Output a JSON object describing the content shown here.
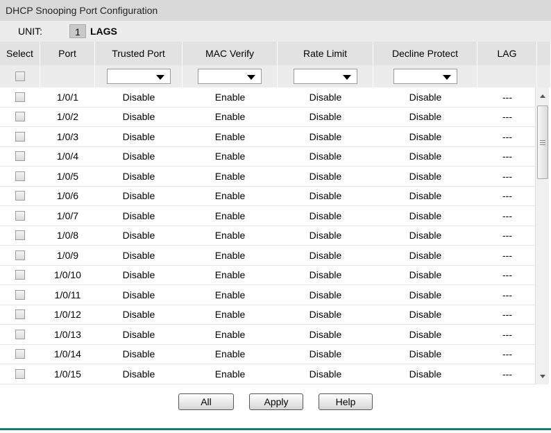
{
  "panel": {
    "title": "DHCP Snooping Port Configuration"
  },
  "unit": {
    "label": "UNIT:",
    "number": "1",
    "lags": "LAGS"
  },
  "columns": [
    "Select",
    "Port",
    "Trusted Port",
    "MAC Verify",
    "Rate Limit",
    "Decline Protect",
    "LAG"
  ],
  "rows": [
    {
      "port": "1/0/1",
      "trusted": "Disable",
      "mac": "Enable",
      "rate": "Disable",
      "decline": "Disable",
      "lag": "---"
    },
    {
      "port": "1/0/2",
      "trusted": "Disable",
      "mac": "Enable",
      "rate": "Disable",
      "decline": "Disable",
      "lag": "---"
    },
    {
      "port": "1/0/3",
      "trusted": "Disable",
      "mac": "Enable",
      "rate": "Disable",
      "decline": "Disable",
      "lag": "---"
    },
    {
      "port": "1/0/4",
      "trusted": "Disable",
      "mac": "Enable",
      "rate": "Disable",
      "decline": "Disable",
      "lag": "---"
    },
    {
      "port": "1/0/5",
      "trusted": "Disable",
      "mac": "Enable",
      "rate": "Disable",
      "decline": "Disable",
      "lag": "---"
    },
    {
      "port": "1/0/6",
      "trusted": "Disable",
      "mac": "Enable",
      "rate": "Disable",
      "decline": "Disable",
      "lag": "---"
    },
    {
      "port": "1/0/7",
      "trusted": "Disable",
      "mac": "Enable",
      "rate": "Disable",
      "decline": "Disable",
      "lag": "---"
    },
    {
      "port": "1/0/8",
      "trusted": "Disable",
      "mac": "Enable",
      "rate": "Disable",
      "decline": "Disable",
      "lag": "---"
    },
    {
      "port": "1/0/9",
      "trusted": "Disable",
      "mac": "Enable",
      "rate": "Disable",
      "decline": "Disable",
      "lag": "---"
    },
    {
      "port": "1/0/10",
      "trusted": "Disable",
      "mac": "Enable",
      "rate": "Disable",
      "decline": "Disable",
      "lag": "---"
    },
    {
      "port": "1/0/11",
      "trusted": "Disable",
      "mac": "Enable",
      "rate": "Disable",
      "decline": "Disable",
      "lag": "---"
    },
    {
      "port": "1/0/12",
      "trusted": "Disable",
      "mac": "Enable",
      "rate": "Disable",
      "decline": "Disable",
      "lag": "---"
    },
    {
      "port": "1/0/13",
      "trusted": "Disable",
      "mac": "Enable",
      "rate": "Disable",
      "decline": "Disable",
      "lag": "---"
    },
    {
      "port": "1/0/14",
      "trusted": "Disable",
      "mac": "Enable",
      "rate": "Disable",
      "decline": "Disable",
      "lag": "---"
    },
    {
      "port": "1/0/15",
      "trusted": "Disable",
      "mac": "Enable",
      "rate": "Disable",
      "decline": "Disable",
      "lag": "---"
    }
  ],
  "buttons": {
    "all": "All",
    "apply": "Apply",
    "help": "Help"
  },
  "colors": {
    "footer_accent": "#1a7a6c",
    "title_bar": "#d9d9d9"
  }
}
